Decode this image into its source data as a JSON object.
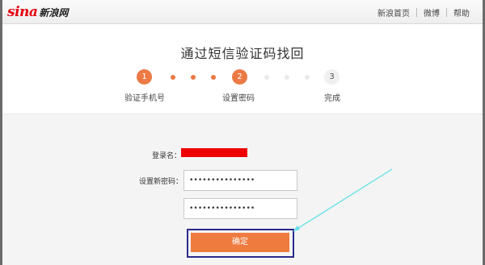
{
  "header": {
    "logo_mark": "sina",
    "logo_text": "新浪网",
    "links": [
      "新浪首页",
      "微博",
      "帮助"
    ]
  },
  "page": {
    "title": "通过短信验证码找回"
  },
  "steps": [
    {
      "number": "1",
      "label": "验证手机号",
      "state": "done"
    },
    {
      "number": "2",
      "label": "设置密码",
      "state": "current"
    },
    {
      "number": "3",
      "label": "完成",
      "state": "pending"
    }
  ],
  "form": {
    "username_label": "登录名：",
    "new_password_label": "设置新密码：",
    "password_value": "•••••••••••••••",
    "confirm_value": "•••••••••••••••",
    "submit_label": "确定"
  },
  "colors": {
    "accent": "#ec7a45",
    "button": "#ef7b3f",
    "logo_red": "#e60012",
    "redaction": "#ee0000",
    "highlight_box": "#2b2a8c",
    "annotation_arrow": "#5fe0e6"
  }
}
